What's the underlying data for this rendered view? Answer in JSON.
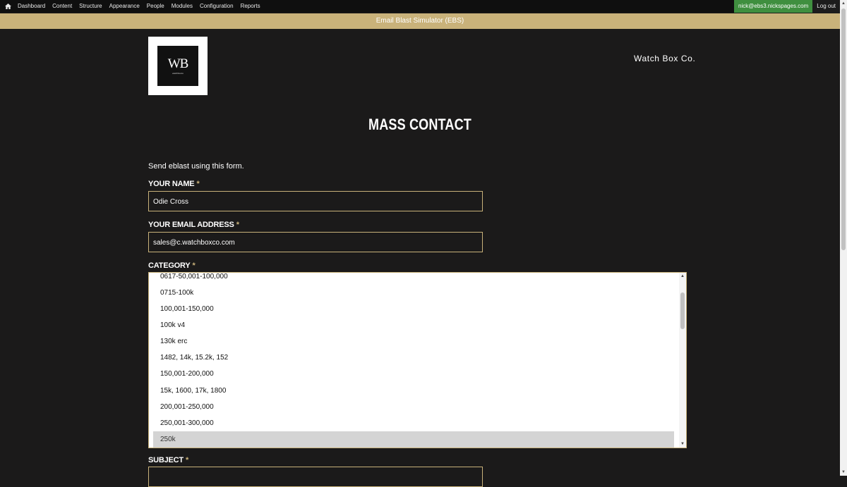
{
  "toolbar": {
    "home_icon": "home-icon",
    "items": [
      "Dashboard",
      "Content",
      "Structure",
      "Appearance",
      "People",
      "Modules",
      "Configuration",
      "Reports"
    ],
    "user": "nick@ebs3.nickspages.com",
    "logout": "Log out"
  },
  "site": {
    "name": "Email Blast Simulator (EBS)"
  },
  "logo": {
    "mark": "WB",
    "sub": "watchboxco"
  },
  "company": "Watch Box Co.",
  "page": {
    "title": "MASS CONTACT",
    "intro": "Send eblast using this form."
  },
  "form": {
    "name": {
      "label": "YOUR NAME",
      "required": "*",
      "value": "Odie Cross"
    },
    "email": {
      "label": "YOUR EMAIL ADDRESS",
      "required": "*",
      "value": "sales@c.watchboxco.com"
    },
    "category": {
      "label": "CATEGORY",
      "required": "*",
      "options": [
        "0617-50,001-100,000",
        "0715-100k",
        "100,001-150,000",
        "100k v4",
        "130k erc",
        "1482, 14k, 15.2k, 152",
        "150,001-200,000",
        "15k, 1600, 17k, 1800",
        "200,001-250,000",
        "250,001-300,000",
        "250k"
      ],
      "selected": "250k"
    },
    "subject": {
      "label": "SUBJECT",
      "required": "*"
    }
  },
  "colors": {
    "accent": "#c9b27a",
    "background": "#1b1a1a",
    "toolbar": "#0f0f0f",
    "user_badge": "#3f8f3f"
  }
}
